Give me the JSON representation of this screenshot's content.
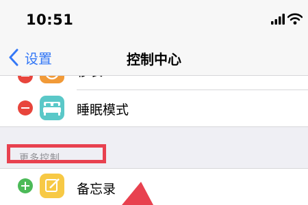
{
  "status_bar": {
    "time": "10:51",
    "signal_icon": "cellular-signal-icon",
    "wifi_icon": "wifi-icon"
  },
  "nav": {
    "back_label": "设置",
    "title": "控制中心"
  },
  "included_controls": [
    {
      "label": "秒表",
      "icon": "stopwatch-icon",
      "icon_color": "#f19a38",
      "action": "remove"
    },
    {
      "label": "睡眠模式",
      "icon": "bed-icon",
      "icon_color": "#5ac8c8",
      "action": "remove"
    }
  ],
  "more_controls": {
    "header": "更多控制",
    "items": [
      {
        "label": "备忘录",
        "icon": "notes-icon",
        "icon_color": "#f7c945",
        "action": "add"
      }
    ]
  },
  "colors": {
    "accent": "#3478f6",
    "remove": "#e8453c",
    "add": "#4cba58",
    "annotation": "#e8414f"
  }
}
